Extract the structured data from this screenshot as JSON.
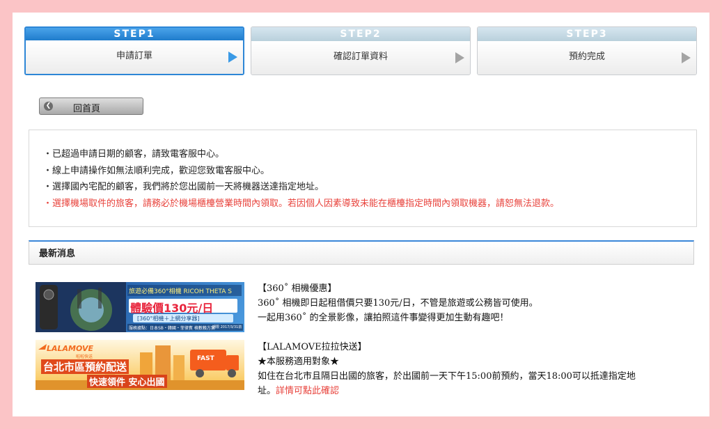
{
  "steps": [
    {
      "head": "STEP1",
      "label": "申請訂單"
    },
    {
      "head": "STEP2",
      "label": "確認訂單資料"
    },
    {
      "head": "STEP3",
      "label": "預約完成"
    }
  ],
  "home_button": {
    "label": "回首頁"
  },
  "notices": [
    "・已超過申請日期的顧客，請致電客服中心。",
    "・線上申請操作如無法順利完成，歡迎您致電客服中心。",
    "・選擇國內宅配的顧客，我們將於您出國前一天將機器送達指定地址。",
    "・選擇機場取件的旅客，請務必於機場櫃檯營業時間內領取。若因個人因素導致未能在櫃檯指定時間內領取機器，請恕無法退款。"
  ],
  "news": {
    "title": "最新消息",
    "items": [
      {
        "banner": {
          "line1": "旅遊必備360°相機 RICOH THETA S",
          "price": "體驗價130元/日",
          "line3": "[360°相機＋上網分享器]",
          "line4": "服務據點：日本SB・韓國・菲律賓 格數賴方案",
          "line5": "期限 2017/3/31前"
        },
        "title": "【360˚ 相機優惠】",
        "lines": [
          "360˚ 相機即日起租借價只要130元/日，不管是旅遊或公務皆可使用。",
          "一起用360˚ 的全景影像，讓拍照這件事變得更加生動有趣吧！"
        ]
      },
      {
        "banner": {
          "brand": "LALAMOVE",
          "brand_sub": "啦啦快送",
          "line1": "台北市區預約配送",
          "line2": "快速領件 安心出國",
          "truck": "FAST"
        },
        "title": "【LALAMOVE拉拉快送】",
        "lines": [
          "★本服務適用對象★",
          "如住在台北市且隔日出國的旅客，於出國前一天下午15:00前預約，當天18:00可以抵達指定地",
          "址。"
        ],
        "link": "詳情可點此確認"
      }
    ]
  }
}
